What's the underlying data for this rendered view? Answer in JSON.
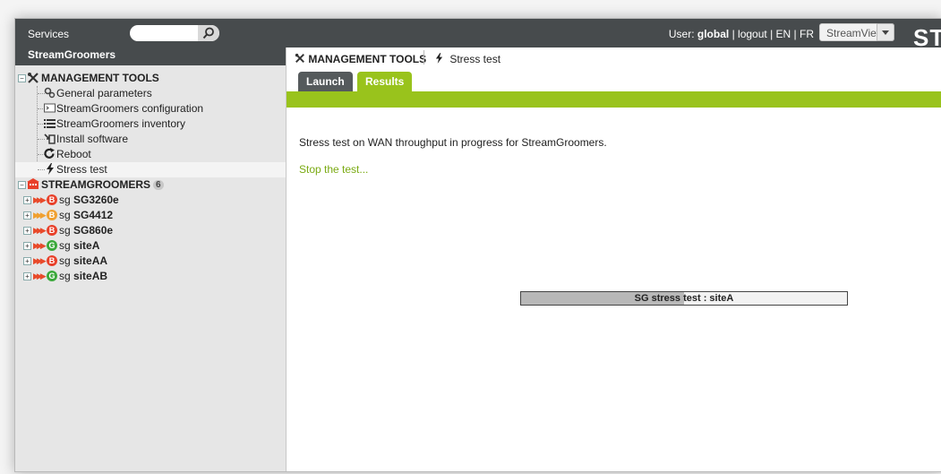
{
  "topbar": {
    "services_label": "Services",
    "search": {
      "placeholder": "",
      "button_icon": "search-icon"
    },
    "user_prefix": "User: ",
    "user_name": "global",
    "sep1": " | ",
    "logout": "logout",
    "sep2": " | ",
    "lang_en": "EN",
    "sep3": " | ",
    "lang_fr": "FR",
    "view_select": {
      "value": "StreamView",
      "icon": "chevron-down-icon"
    },
    "logo_text": "ST"
  },
  "left_panel": {
    "title": "StreamGroomers",
    "management": {
      "label": "MANAGEMENT TOOLS",
      "icon": "tools-icon",
      "items": [
        {
          "label": "General parameters",
          "icon": "gears-icon"
        },
        {
          "label": "StreamGroomers configuration",
          "icon": "terminal-icon"
        },
        {
          "label": "StreamGroomers inventory",
          "icon": "list-icon"
        },
        {
          "label": "Install software",
          "icon": "install-icon"
        },
        {
          "label": "Reboot",
          "icon": "reboot-icon"
        },
        {
          "label": "Stress test",
          "icon": "lightning-icon"
        }
      ]
    },
    "streamgroomers": {
      "label": "STREAMGROOMERS",
      "count": "6",
      "icon": "building-icon",
      "items": [
        {
          "status": "B",
          "status_color": "#e8402a",
          "arrow_color": "#e84a2b",
          "prefix": "sg ",
          "name": "SG3260e"
        },
        {
          "status": "B",
          "status_color": "#f0a030",
          "arrow_color": "#f0a030",
          "prefix": "sg ",
          "name": "SG4412"
        },
        {
          "status": "B",
          "status_color": "#e8402a",
          "arrow_color": "#e84a2b",
          "prefix": "sg ",
          "name": "SG860e"
        },
        {
          "status": "G",
          "status_color": "#3aa83a",
          "arrow_color": "#e84a2b",
          "prefix": "sg ",
          "name": "siteA"
        },
        {
          "status": "B",
          "status_color": "#e8402a",
          "arrow_color": "#e84a2b",
          "prefix": "sg ",
          "name": "siteAA"
        },
        {
          "status": "G",
          "status_color": "#3aa83a",
          "arrow_color": "#e84a2b",
          "prefix": "sg ",
          "name": "siteAB"
        }
      ]
    }
  },
  "breadcrumb": {
    "tools": "MANAGEMENT TOOLS",
    "current": "Stress test"
  },
  "tabs": [
    {
      "label": "Launch",
      "active": false
    },
    {
      "label": "Results",
      "active": true
    }
  ],
  "main": {
    "message": "Stress test on WAN throughput in progress for StreamGroomers.",
    "stop_link": "Stop the test...",
    "progress": {
      "label": "SG stress test : siteA",
      "percent": 50
    }
  },
  "colors": {
    "accent_green": "#99c31c",
    "topbar": "#474b4d",
    "link_green": "#7aaa12"
  }
}
